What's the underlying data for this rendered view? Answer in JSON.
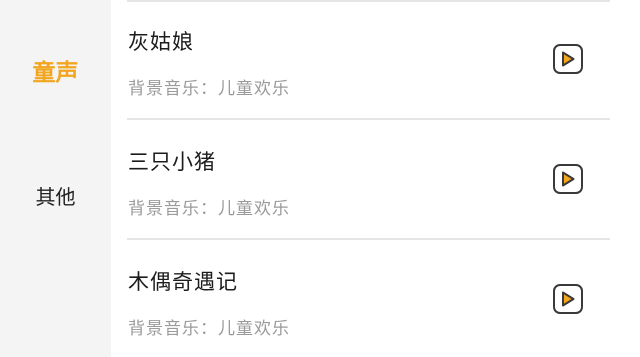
{
  "sidebar": {
    "categories": [
      {
        "label": "童声",
        "active": true
      },
      {
        "label": "其他",
        "active": false
      }
    ]
  },
  "songs": [
    {
      "title": "灰姑娘",
      "subtitle": "背景音乐：儿童欢乐",
      "icon": "play-icon"
    },
    {
      "title": "三只小猪",
      "subtitle": "背景音乐：儿童欢乐",
      "icon": "play-icon"
    },
    {
      "title": "木偶奇遇记",
      "subtitle": "背景音乐：儿童欢乐",
      "icon": "play-icon"
    }
  ],
  "colors": {
    "accent": "#f2a51f",
    "play_fill": "#f5a61c",
    "sidebar_bg": "#f4f4f4",
    "list_bg": "#ffffff"
  }
}
